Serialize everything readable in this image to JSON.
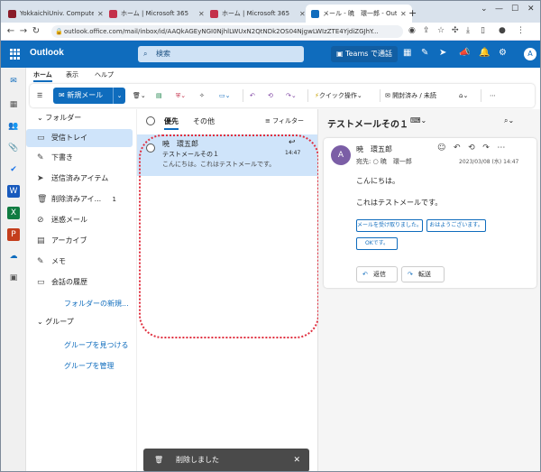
{
  "browser": {
    "tabs": [
      {
        "title": "YokkaichiUniv. Compute",
        "fav_color": "#8a1c2a"
      },
      {
        "title": "ホーム | Microsoft 365",
        "fav_color": "#c4314b"
      },
      {
        "title": "ホーム | Microsoft 365",
        "fav_color": "#c4314b"
      },
      {
        "title": "メール - 暁　環一郎 - Out",
        "fav_color": "#0f6cbd"
      }
    ],
    "url": "outlook.office.com/mail/inbox/id/AAQkAGEyNGI0NjhlLWUxN2QtNDk2OS04NjgwLWIzZTE4YjdiZGJhY..."
  },
  "header": {
    "app_name": "Outlook",
    "search_placeholder": "検索",
    "teams_button": "Teams で通話",
    "avatar_initial": "A"
  },
  "ribbon": {
    "tabs": [
      "ホーム",
      "表示",
      "ヘルプ"
    ],
    "new_mail": "新規メール",
    "quick_steps": "クイック操作",
    "read_unread": "開封済み / 未読"
  },
  "folders": {
    "section": "フォルダー",
    "items": [
      {
        "label": "受信トレイ",
        "icon": "inbox-icon",
        "count": ""
      },
      {
        "label": "下書き",
        "icon": "pencil-icon",
        "count": ""
      },
      {
        "label": "送信済みアイテム",
        "icon": "send-icon",
        "count": ""
      },
      {
        "label": "削除済みアイ...",
        "icon": "trash-icon",
        "count": "1"
      },
      {
        "label": "迷惑メール",
        "icon": "junk-icon",
        "count": ""
      },
      {
        "label": "アーカイブ",
        "icon": "archive-icon",
        "count": ""
      },
      {
        "label": "メモ",
        "icon": "note-icon",
        "count": ""
      },
      {
        "label": "会話の履歴",
        "icon": "folder-icon",
        "count": ""
      }
    ],
    "new_folder": "フォルダーの新規...",
    "groups_section": "グループ",
    "find_groups": "グループを見つける",
    "manage_groups": "グループを管理"
  },
  "message_list": {
    "tab_focused": "優先",
    "tab_other": "その他",
    "filter": "フィルター",
    "item": {
      "from": "暁　環五郎",
      "subject": "テストメールその１",
      "preview": "こんにちは。これはテストメールです。",
      "time": "14:47"
    }
  },
  "reading": {
    "subject": "テストメールその１",
    "sender": "暁　環五郎",
    "avatar_initial": "A",
    "to_label": "宛先:",
    "to": "暁　環一郎",
    "date": "2023/03/08 (水) 14:47",
    "body_line1": "こんにちは。",
    "body_line2": "これはテストメールです。",
    "suggestions": [
      "メールを受け取りました。",
      "おはようございます。",
      "OKです。"
    ],
    "reply": "返信",
    "forward": "転送"
  },
  "toast": {
    "message": "削除しました"
  }
}
